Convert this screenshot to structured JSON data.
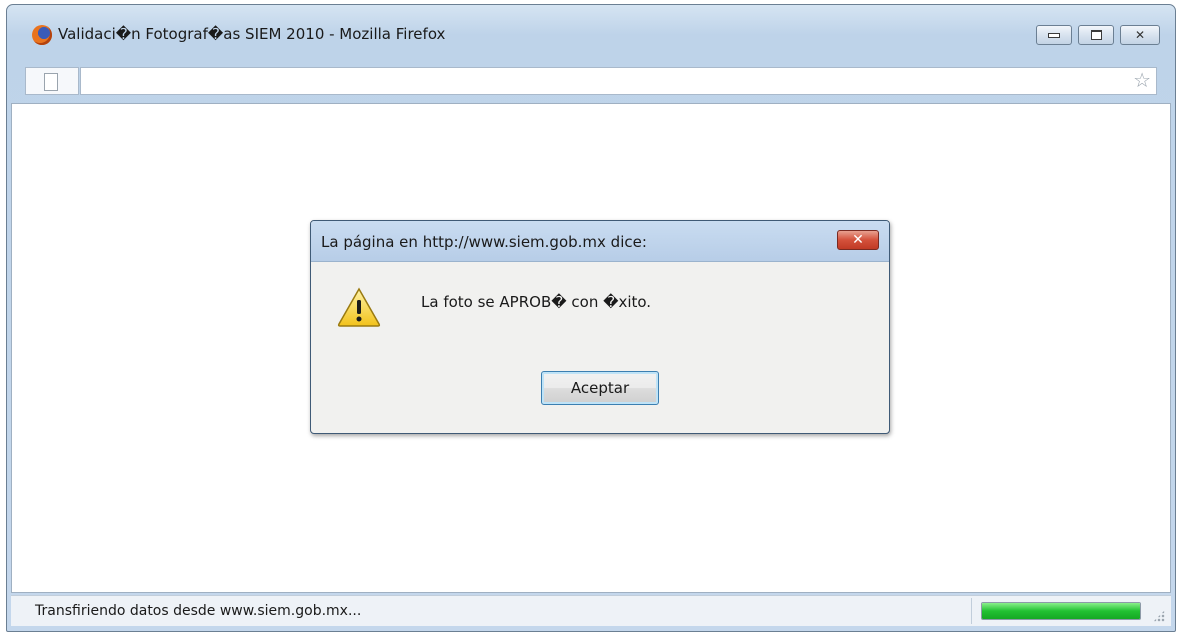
{
  "window": {
    "title": "Validaci�n Fotograf�as SIEM 2010 - Mozilla Firefox",
    "icon": "firefox-icon"
  },
  "urlbar": {
    "value": "",
    "placeholder": ""
  },
  "dialog": {
    "title": "La página en http://www.siem.gob.mx dice:",
    "close_label": "✕",
    "message": "La foto se APROB� con �xito.",
    "ok_label": "Aceptar",
    "icon": "warning-icon"
  },
  "status": {
    "text": "Transfiriendo datos desde www.siem.gob.mx...",
    "progress": 1.0
  },
  "colors": {
    "progress": "#22c132",
    "dialog_close": "#c03a25",
    "titlebar": "#bed3e9"
  }
}
